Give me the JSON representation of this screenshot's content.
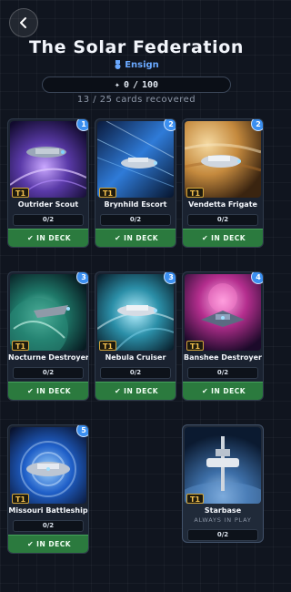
{
  "header": {
    "back_icon": "chevron-left-icon",
    "title": "The Solar Federation",
    "rank_icon": "medal-icon",
    "rank": "Ensign",
    "progress_icon": "plus-icon",
    "progress_value": "0",
    "progress_separator": "/",
    "progress_max": "100",
    "progress_fraction": 0,
    "recovered": "13 / 25 cards recovered"
  },
  "colors": {
    "deck_green": "#2b7a3e",
    "badge_blue": "#3b8ff0",
    "tier_gold": "#f4c14e",
    "rank_blue": "#6aa9ff"
  },
  "cards": [
    {
      "name": "Outrider Scout",
      "tier": "T1",
      "badge": "1",
      "count": "0/2",
      "button": "IN DECK",
      "button_icon": "check-icon",
      "art": "purple-nebula-ship"
    },
    {
      "name": "Brynhild Escort",
      "tier": "T1",
      "badge": "2",
      "count": "0/2",
      "button": "IN DECK",
      "button_icon": "check-icon",
      "art": "blue-warp-ship"
    },
    {
      "name": "Vendetta Frigate",
      "tier": "T1",
      "badge": "2",
      "count": "0/2",
      "button": "IN DECK",
      "button_icon": "check-icon",
      "art": "gas-giant-ship"
    },
    {
      "name": "Nocturne Destroyer",
      "tier": "T1",
      "badge": "3",
      "count": "0/2",
      "button": "IN DECK",
      "button_icon": "check-icon",
      "art": "green-planet-ship"
    },
    {
      "name": "Nebula Cruiser",
      "tier": "T1",
      "badge": "3",
      "count": "0/2",
      "button": "IN DECK",
      "button_icon": "check-icon",
      "art": "teal-nebula-ship"
    },
    {
      "name": "Banshee Destroyer",
      "tier": "T1",
      "badge": "4",
      "count": "0/2",
      "button": "IN DECK",
      "button_icon": "check-icon",
      "art": "pink-nebula-ship"
    },
    {
      "name": "Missouri Battleship",
      "tier": "T1",
      "badge": "5",
      "count": "0/2",
      "button": "IN DECK",
      "button_icon": "check-icon",
      "art": "blue-vortex-ship"
    }
  ],
  "starbase": {
    "name": "Starbase",
    "tier": "T1",
    "subtitle": "ALWAYS IN PLAY",
    "count": "0/2",
    "art": "earth-station"
  }
}
